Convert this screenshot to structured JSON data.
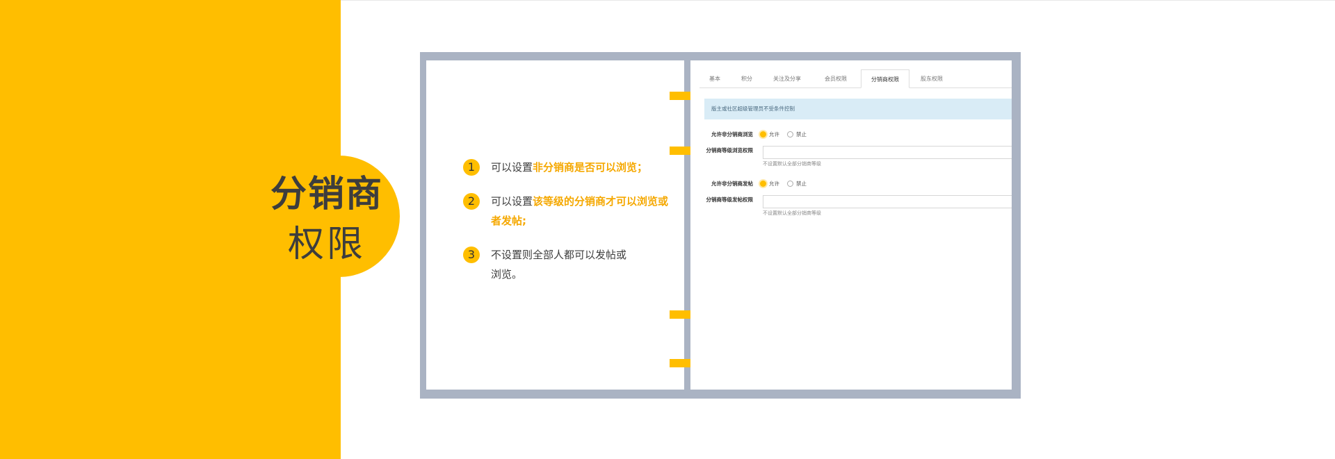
{
  "title": {
    "main": "分销商",
    "sub": "权限"
  },
  "notes": [
    {
      "num": "1",
      "prefix": "可以设置",
      "highlight": "非分销商是否可以浏览；",
      "suffix": ""
    },
    {
      "num": "2",
      "prefix": "可以设置",
      "highlight": "该等级的分销商才可以浏览或者发帖;",
      "suffix": ""
    },
    {
      "num": "3",
      "prefix": "不设置则全部人都可以发帖或浏览。",
      "highlight": "",
      "suffix": ""
    }
  ],
  "screen": {
    "tabs": [
      "基本",
      "积分",
      "关注及分享",
      "会员权限",
      "分销商权限",
      "股东权限"
    ],
    "active_tab": "分销商权限",
    "notice": "版主或社区超级管理员不受条件控制",
    "rows": [
      {
        "label": "允许非分销商浏览",
        "type": "radio",
        "options": [
          "允许",
          "禁止"
        ],
        "selected": "允许"
      },
      {
        "label": "分销商等级浏览权限",
        "type": "input",
        "value": "",
        "hint": "不设置默认全部分销商等级"
      },
      {
        "label": "允许非分销商发帖",
        "type": "radio",
        "options": [
          "允许",
          "禁止"
        ],
        "selected": "允许"
      },
      {
        "label": "分销商等级发帖权限",
        "type": "input",
        "value": "",
        "hint": "不设置默认全部分销商等级"
      }
    ]
  },
  "colors": {
    "accent": "#ffbe00",
    "highlight_text": "#f5a800",
    "frame": "#aab3c3",
    "title_text": "#3d3d3d",
    "notice_bg": "#d9ecf6"
  }
}
